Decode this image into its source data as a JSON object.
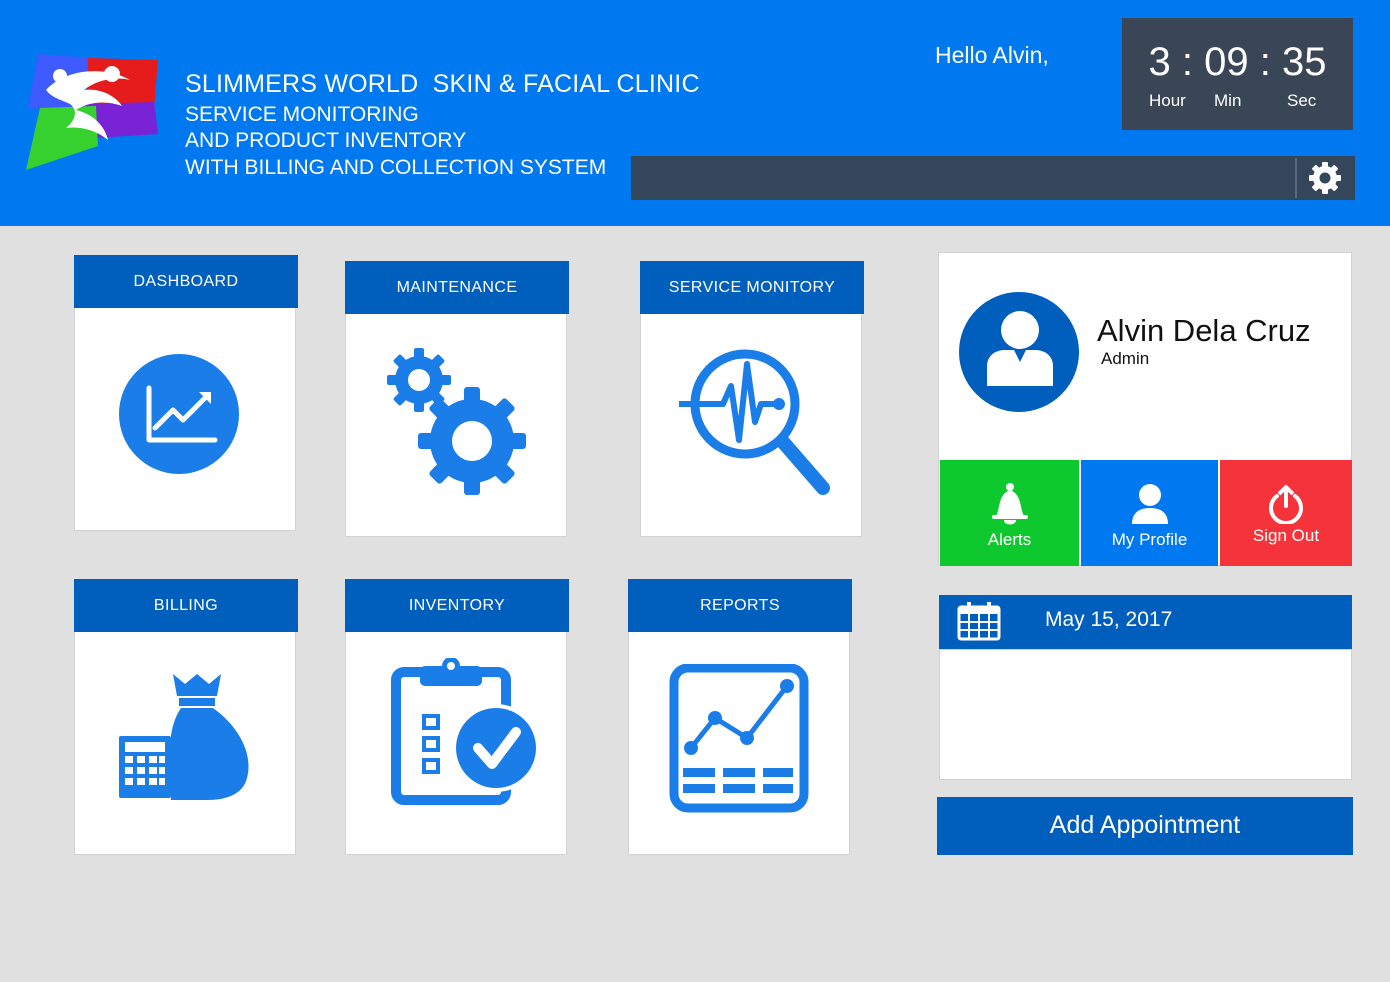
{
  "header": {
    "title": "SLIMMERS WORLD  SKIN & FACIAL CLINIC",
    "subtitle_lines": [
      "SERVICE MONITORING",
      "AND PRODUCT INVENTORY",
      "WITH BILLING AND COLLECTION SYSTEM"
    ],
    "greeting": "Hello Alvin,",
    "settings_icon": "gear-icon"
  },
  "clock": {
    "time": "3 : 09 : 35",
    "hour_label": "Hour",
    "min_label": "Min",
    "sec_label": "Sec"
  },
  "tiles": [
    {
      "label": "DASHBOARD",
      "icon": "trend-chart-icon"
    },
    {
      "label": "MAINTENANCE",
      "icon": "gears-icon"
    },
    {
      "label": "SERVICE MONITORY",
      "icon": "pulse-magnifier-icon"
    },
    {
      "label": "BILLING",
      "icon": "money-bag-calculator-icon"
    },
    {
      "label": "INVENTORY",
      "icon": "clipboard-check-icon"
    },
    {
      "label": "REPORTS",
      "icon": "report-chart-icon"
    }
  ],
  "profile": {
    "name": "Alvin Dela Cruz",
    "role": "Admin",
    "buttons": [
      {
        "label": "Alerts",
        "icon": "bell-icon",
        "color": "#0ec92e"
      },
      {
        "label": "My Profile",
        "icon": "user-icon",
        "color": "#0078f0"
      },
      {
        "label": "Sign Out",
        "icon": "power-icon",
        "color": "#f5333a"
      }
    ]
  },
  "calendar": {
    "date": "May 15, 2017",
    "icon": "calendar-icon"
  },
  "add_appointment": "Add Appointment",
  "colors": {
    "header_blue": "#0078f0",
    "tile_blue": "#005ebd",
    "icon_blue": "#1a7de8",
    "background": "#e0e0e0"
  }
}
